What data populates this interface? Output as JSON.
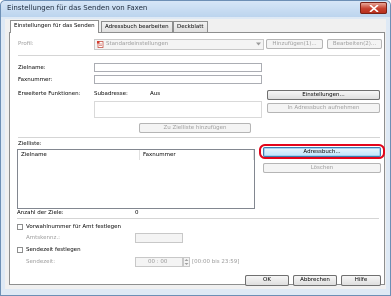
{
  "window": {
    "title": "Einstellungen für das Senden von Faxen"
  },
  "tabs": [
    {
      "label": "Einstellungen für das Senden"
    },
    {
      "label": "Adressbuch bearbeiten"
    },
    {
      "label": "Deckblatt"
    }
  ],
  "profile": {
    "label": "Profil:",
    "value": "Standardeinstellungen",
    "add_button": "Hinzufügen(1)...",
    "edit_button": "Bearbeiten(2)..."
  },
  "recipient": {
    "name_label": "Zielname:",
    "name_value": "",
    "fax_label": "Faxnummer:",
    "fax_value": ""
  },
  "extended": {
    "label": "Erweiterte Funktionen:",
    "subaddress_label": "Subadresse:",
    "subaddress_value": "Aus",
    "settings_button": "Einstellungen...",
    "save_to_addressbook_button": "In Adressbuch aufnehmen"
  },
  "add_to_list_button": "Zu Zielliste hinzufügen",
  "target_list": {
    "label": "Zielliste:",
    "columns": [
      "Zielname",
      "Faxnummer"
    ],
    "rows": []
  },
  "addressbook_button": "Adressbuch...",
  "delete_button": "Löschen",
  "count": {
    "label": "Anzahl der Ziele:",
    "value": "0"
  },
  "prefix": {
    "checkbox_label": "Vorwahlnummer für Amt festlegen",
    "checked": false,
    "outside_label": "Amtskennz.:",
    "outside_value": ""
  },
  "send_time": {
    "checkbox_label": "Sendezeit festlegen",
    "checked": false,
    "time_label": "Sendezeit:",
    "time_value": "00 : 00",
    "range_hint": "[00:00 bis 23:59]"
  },
  "footer": {
    "ok": "OK",
    "cancel": "Abbrechen",
    "help": "Hilfe"
  },
  "colors": {
    "highlight": "#e3051b",
    "accent": "#3c7fb1"
  }
}
